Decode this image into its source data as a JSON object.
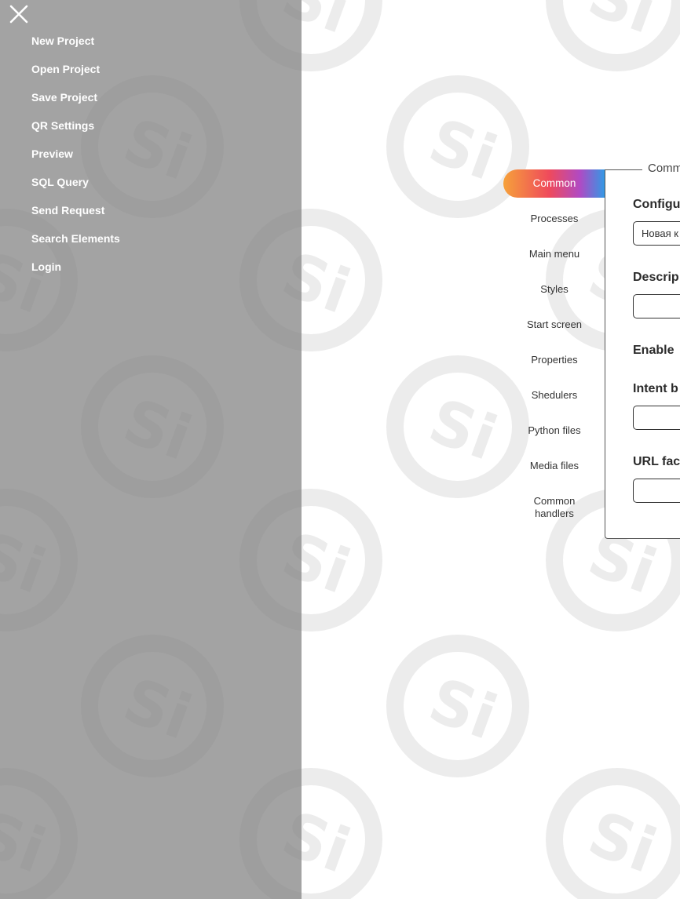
{
  "drawer": {
    "close_icon": "close-icon",
    "items": [
      {
        "label": "New Project"
      },
      {
        "label": "Open Project"
      },
      {
        "label": "Save Project"
      },
      {
        "label": "QR Settings"
      },
      {
        "label": "Preview"
      },
      {
        "label": "SQL Query"
      },
      {
        "label": "Send Request"
      },
      {
        "label": "Search Elements"
      },
      {
        "label": "Login"
      }
    ]
  },
  "tabs": {
    "items": [
      {
        "label": "Common",
        "active": true
      },
      {
        "label": "Processes"
      },
      {
        "label": "Main menu"
      },
      {
        "label": "Styles"
      },
      {
        "label": "Start screen"
      },
      {
        "label": "Properties"
      },
      {
        "label": "Shedulers"
      },
      {
        "label": "Python files"
      },
      {
        "label": "Media files"
      },
      {
        "label": "Common",
        "label2": "handlers"
      }
    ]
  },
  "panel": {
    "legend": "Comm",
    "fields": [
      {
        "label": "Configu",
        "value": "Новая к"
      },
      {
        "label": "Descrip",
        "value": ""
      },
      {
        "label": "Enable"
      },
      {
        "label": "Intent b",
        "value": ""
      },
      {
        "label": "URL fac",
        "value": ""
      }
    ]
  },
  "watermark": {
    "text": "Si"
  },
  "colors": {
    "drawer_overlay": "#808080",
    "active_tab_gradient_start": "#f6a13a",
    "active_tab_gradient_mid": "#ef4a5c",
    "active_tab_gradient_end": "#2f9be6"
  }
}
